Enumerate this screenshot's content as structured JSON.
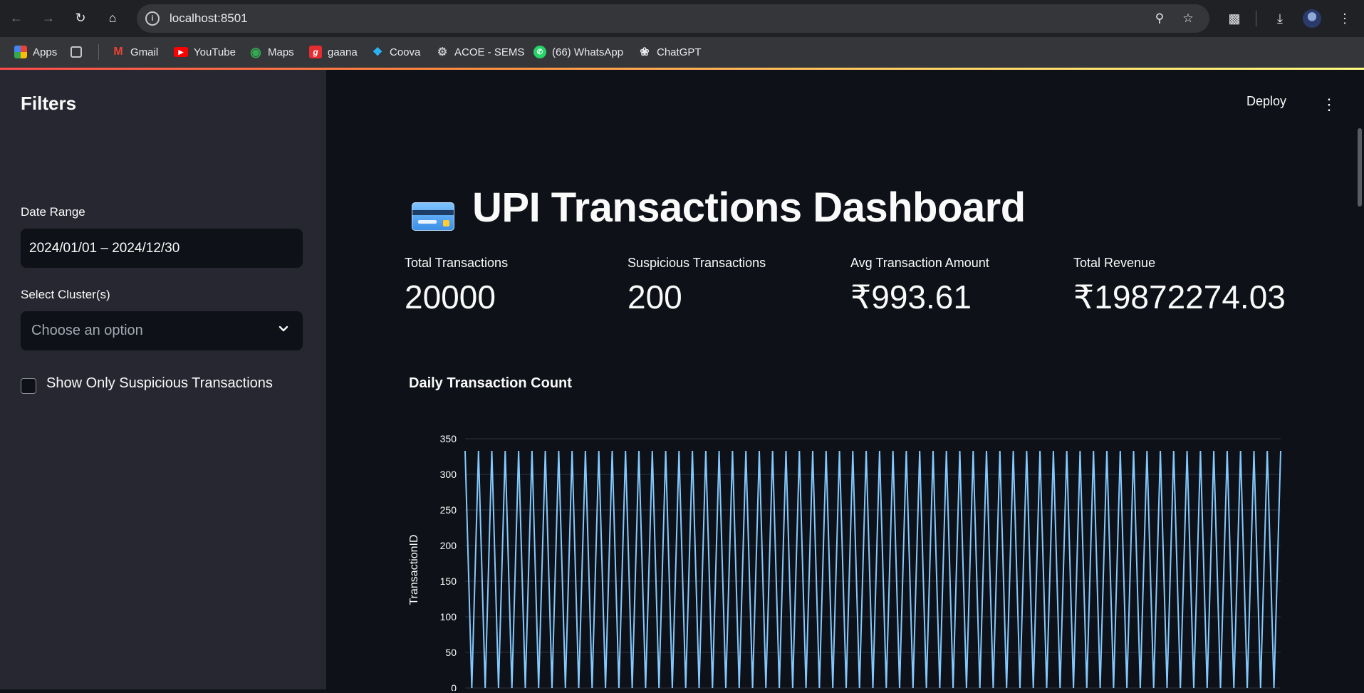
{
  "browser": {
    "url": "localhost:8501",
    "bookmarks": [
      {
        "label": "Apps",
        "icon": "apps-grid-icon"
      },
      {
        "label": "",
        "icon": "tab-groups-icon"
      },
      {
        "label": "Gmail",
        "icon": "gmail-icon"
      },
      {
        "label": "YouTube",
        "icon": "youtube-icon"
      },
      {
        "label": "Maps",
        "icon": "maps-icon"
      },
      {
        "label": "gaana",
        "icon": "gaana-icon"
      },
      {
        "label": "Coova",
        "icon": "coova-icon"
      },
      {
        "label": "ACOE - SEMS",
        "icon": "acoe-icon"
      },
      {
        "label": "(66) WhatsApp",
        "icon": "whatsapp-icon"
      },
      {
        "label": "ChatGPT",
        "icon": "chatgpt-icon"
      }
    ]
  },
  "sidebar": {
    "title": "Filters",
    "date_range_label": "Date Range",
    "date_range_value": "2024/01/01 – 2024/12/30",
    "cluster_label": "Select Cluster(s)",
    "cluster_placeholder": "Choose an option",
    "suspicious_checkbox_label": "Show Only Suspicious Transactions",
    "suspicious_checked": false
  },
  "header": {
    "deploy_label": "Deploy"
  },
  "main": {
    "title": "UPI Transactions Dashboard",
    "metrics": [
      {
        "label": "Total Transactions",
        "value": "20000"
      },
      {
        "label": "Suspicious Transactions",
        "value": "200"
      },
      {
        "label": "Avg Transaction Amount",
        "value": "₹993.61"
      },
      {
        "label": "Total Revenue",
        "value": "₹19872274.03"
      }
    ],
    "chart_title": "Daily Transaction Count"
  },
  "colors": {
    "line": "#83c9ff",
    "grid": "#31333f",
    "accent": "#ff4b4b"
  },
  "chart_data": {
    "type": "line",
    "title": "Daily Transaction Count",
    "xlabel": "",
    "ylabel": "TransactionID",
    "ylim": [
      0,
      350
    ],
    "yticks": [
      0,
      50,
      100,
      150,
      200,
      250,
      300,
      350
    ],
    "grid": true,
    "series": [
      {
        "values": [
          333,
          0,
          333,
          0,
          333,
          0,
          333,
          0,
          333,
          0,
          333,
          0,
          333,
          0,
          333,
          0,
          333,
          0,
          333,
          0,
          333,
          0,
          333,
          0,
          333,
          0,
          333,
          0,
          333,
          0,
          333,
          0,
          333,
          0,
          333,
          0,
          333,
          0,
          333,
          0,
          333,
          0,
          333,
          0,
          333,
          0,
          333,
          0,
          333,
          0,
          333,
          0,
          333,
          0,
          333,
          0,
          333,
          0,
          333,
          0,
          333,
          0,
          333,
          0,
          333,
          0,
          333,
          0,
          333,
          0,
          333,
          0,
          333,
          0,
          333,
          0,
          333,
          0,
          333,
          0,
          333,
          0,
          333,
          0,
          333,
          0,
          333,
          0,
          333,
          0,
          333,
          0,
          333,
          0,
          333,
          0,
          333,
          0,
          333,
          0,
          333,
          0,
          333,
          0,
          333,
          0,
          333,
          0,
          333,
          0,
          333,
          0,
          333,
          0,
          333,
          0,
          333,
          0,
          333,
          0,
          333,
          0,
          333
        ]
      }
    ]
  }
}
